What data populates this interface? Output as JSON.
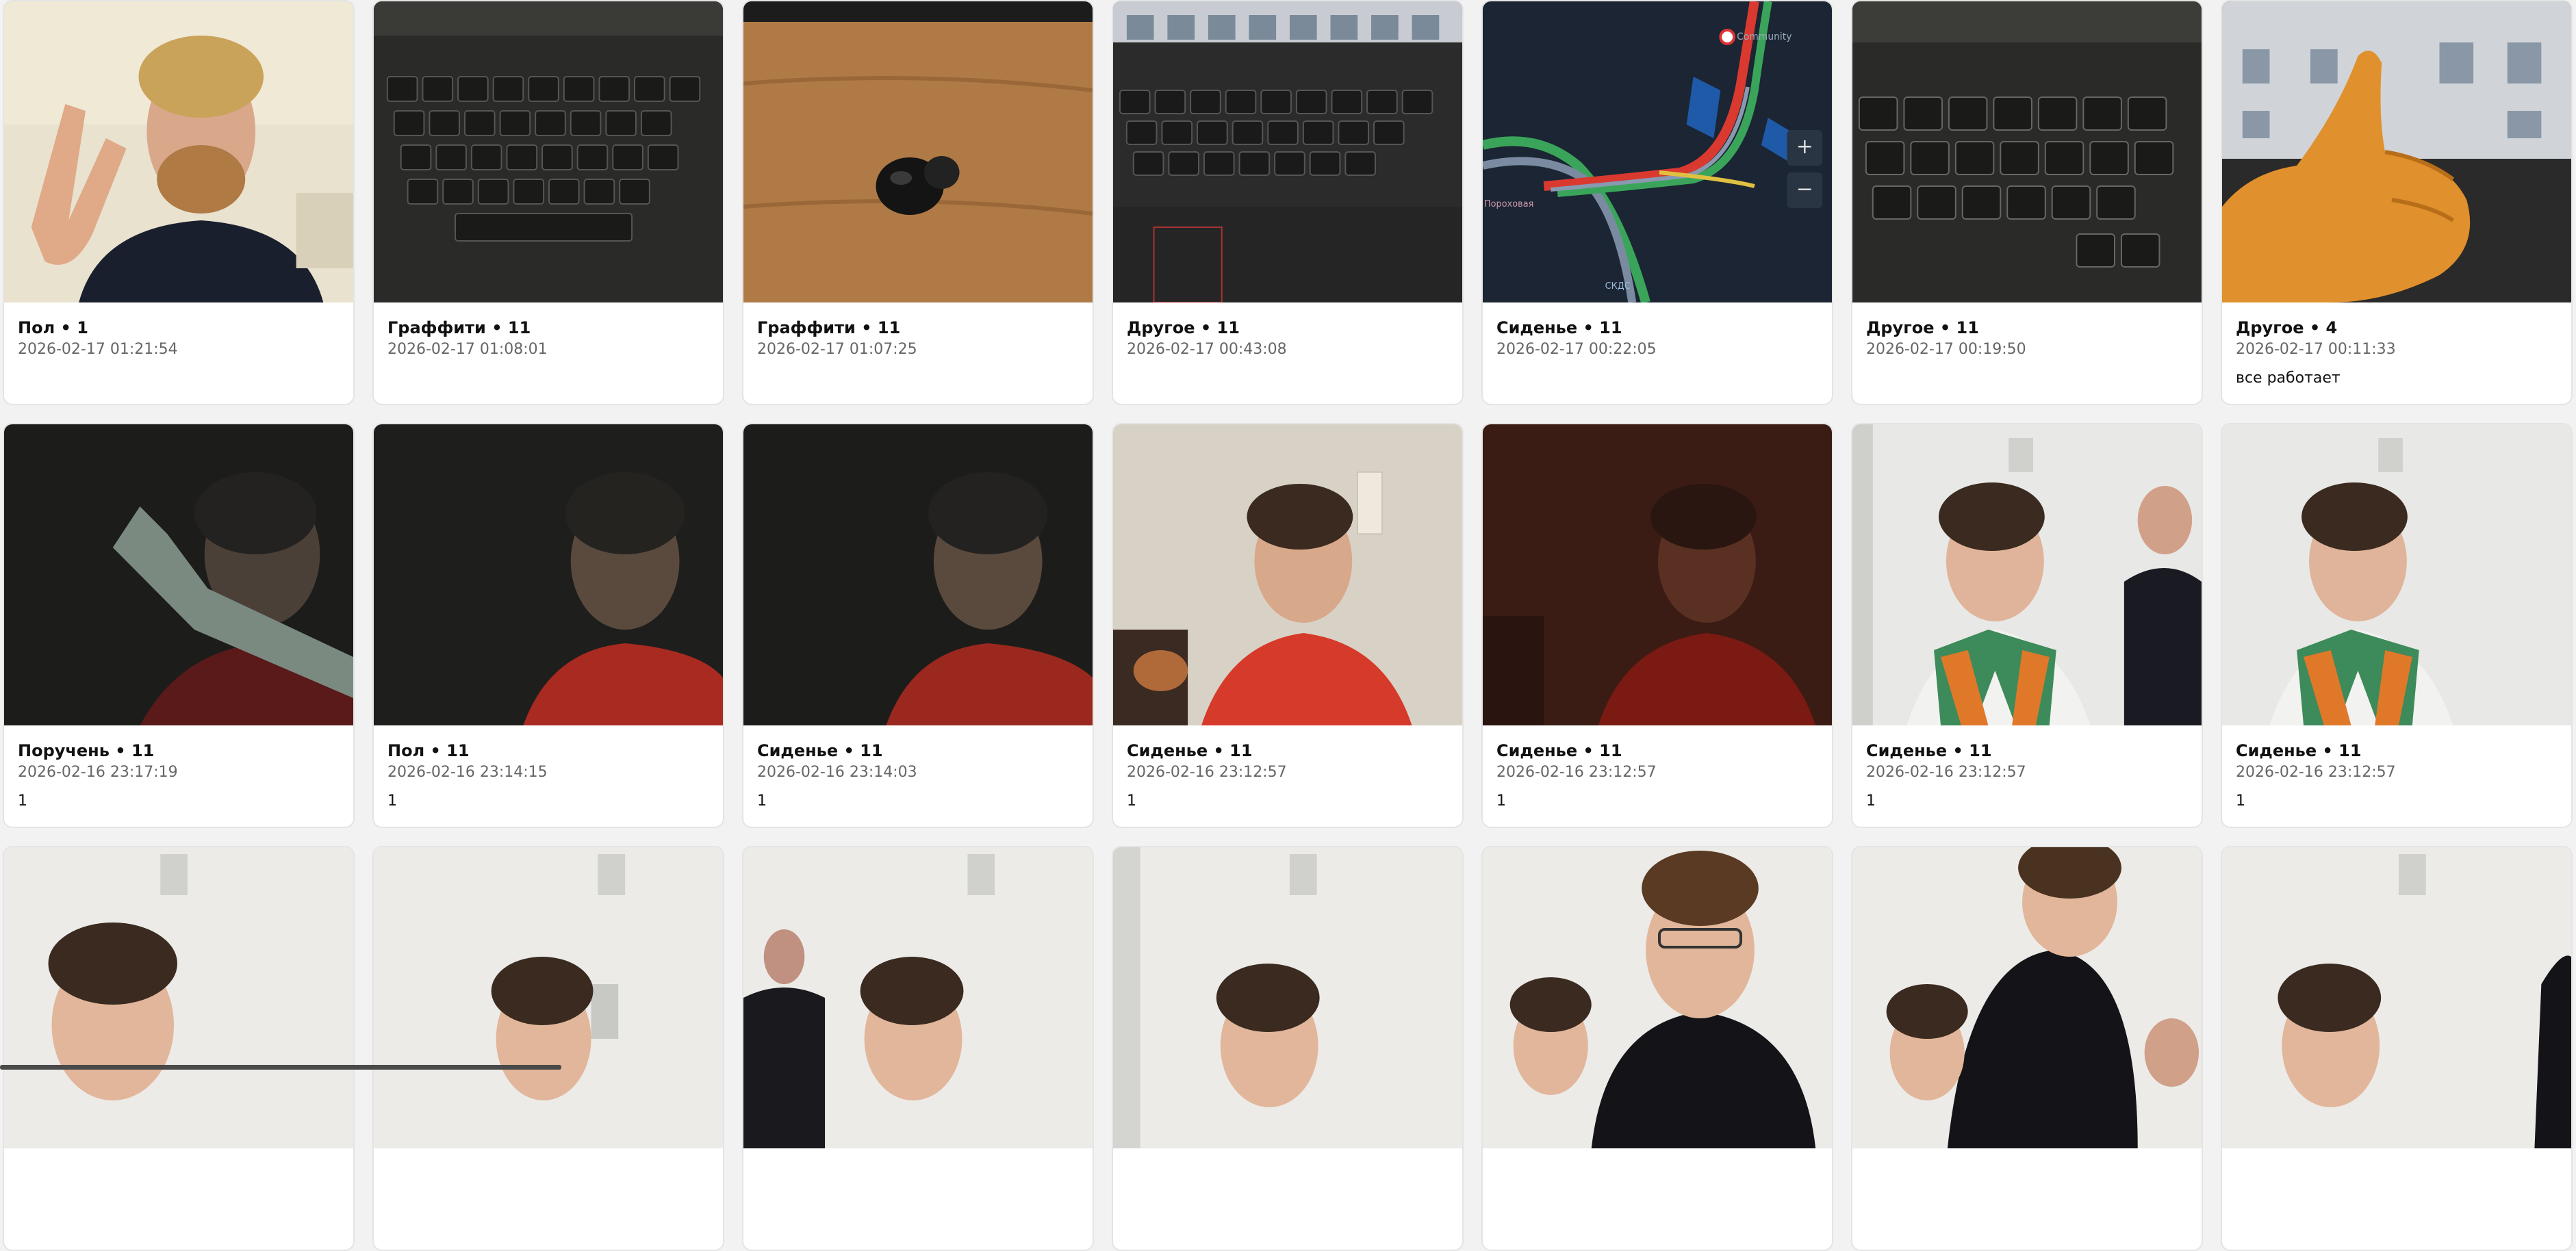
{
  "cards": [
    {
      "title": "Пол • 1",
      "date": "2026-02-17 01:21:54",
      "note": ""
    },
    {
      "title": "Граффити • 11",
      "date": "2026-02-17 01:08:01",
      "note": ""
    },
    {
      "title": "Граффити • 11",
      "date": "2026-02-17 01:07:25",
      "note": ""
    },
    {
      "title": "Другое • 11",
      "date": "2026-02-17 00:43:08",
      "note": ""
    },
    {
      "title": "Сиденье • 11",
      "date": "2026-02-17 00:22:05",
      "note": ""
    },
    {
      "title": "Другое • 11",
      "date": "2026-02-17 00:19:50",
      "note": ""
    },
    {
      "title": "Другое • 4",
      "date": "2026-02-17 00:11:33",
      "note": "все работает"
    },
    {
      "title": "Поручень • 11",
      "date": "2026-02-16 23:17:19",
      "note": "1"
    },
    {
      "title": "Пол • 11",
      "date": "2026-02-16 23:14:15",
      "note": "1"
    },
    {
      "title": "Сиденье • 11",
      "date": "2026-02-16 23:14:03",
      "note": "1"
    },
    {
      "title": "Сиденье • 11",
      "date": "2026-02-16 23:12:57",
      "note": "1"
    },
    {
      "title": "Сиденье • 11",
      "date": "2026-02-16 23:12:57",
      "note": "1"
    },
    {
      "title": "Сиденье • 11",
      "date": "2026-02-16 23:12:57",
      "note": "1"
    },
    {
      "title": "Сиденье • 11",
      "date": "2026-02-16 23:12:57",
      "note": "1"
    }
  ],
  "map_labels": {
    "community": "Community",
    "street1": "Пороховая",
    "street2": "СКДС"
  },
  "colors": {
    "background": "#f2f2f2",
    "card": "#ffffff",
    "border": "#e4e4e4"
  }
}
